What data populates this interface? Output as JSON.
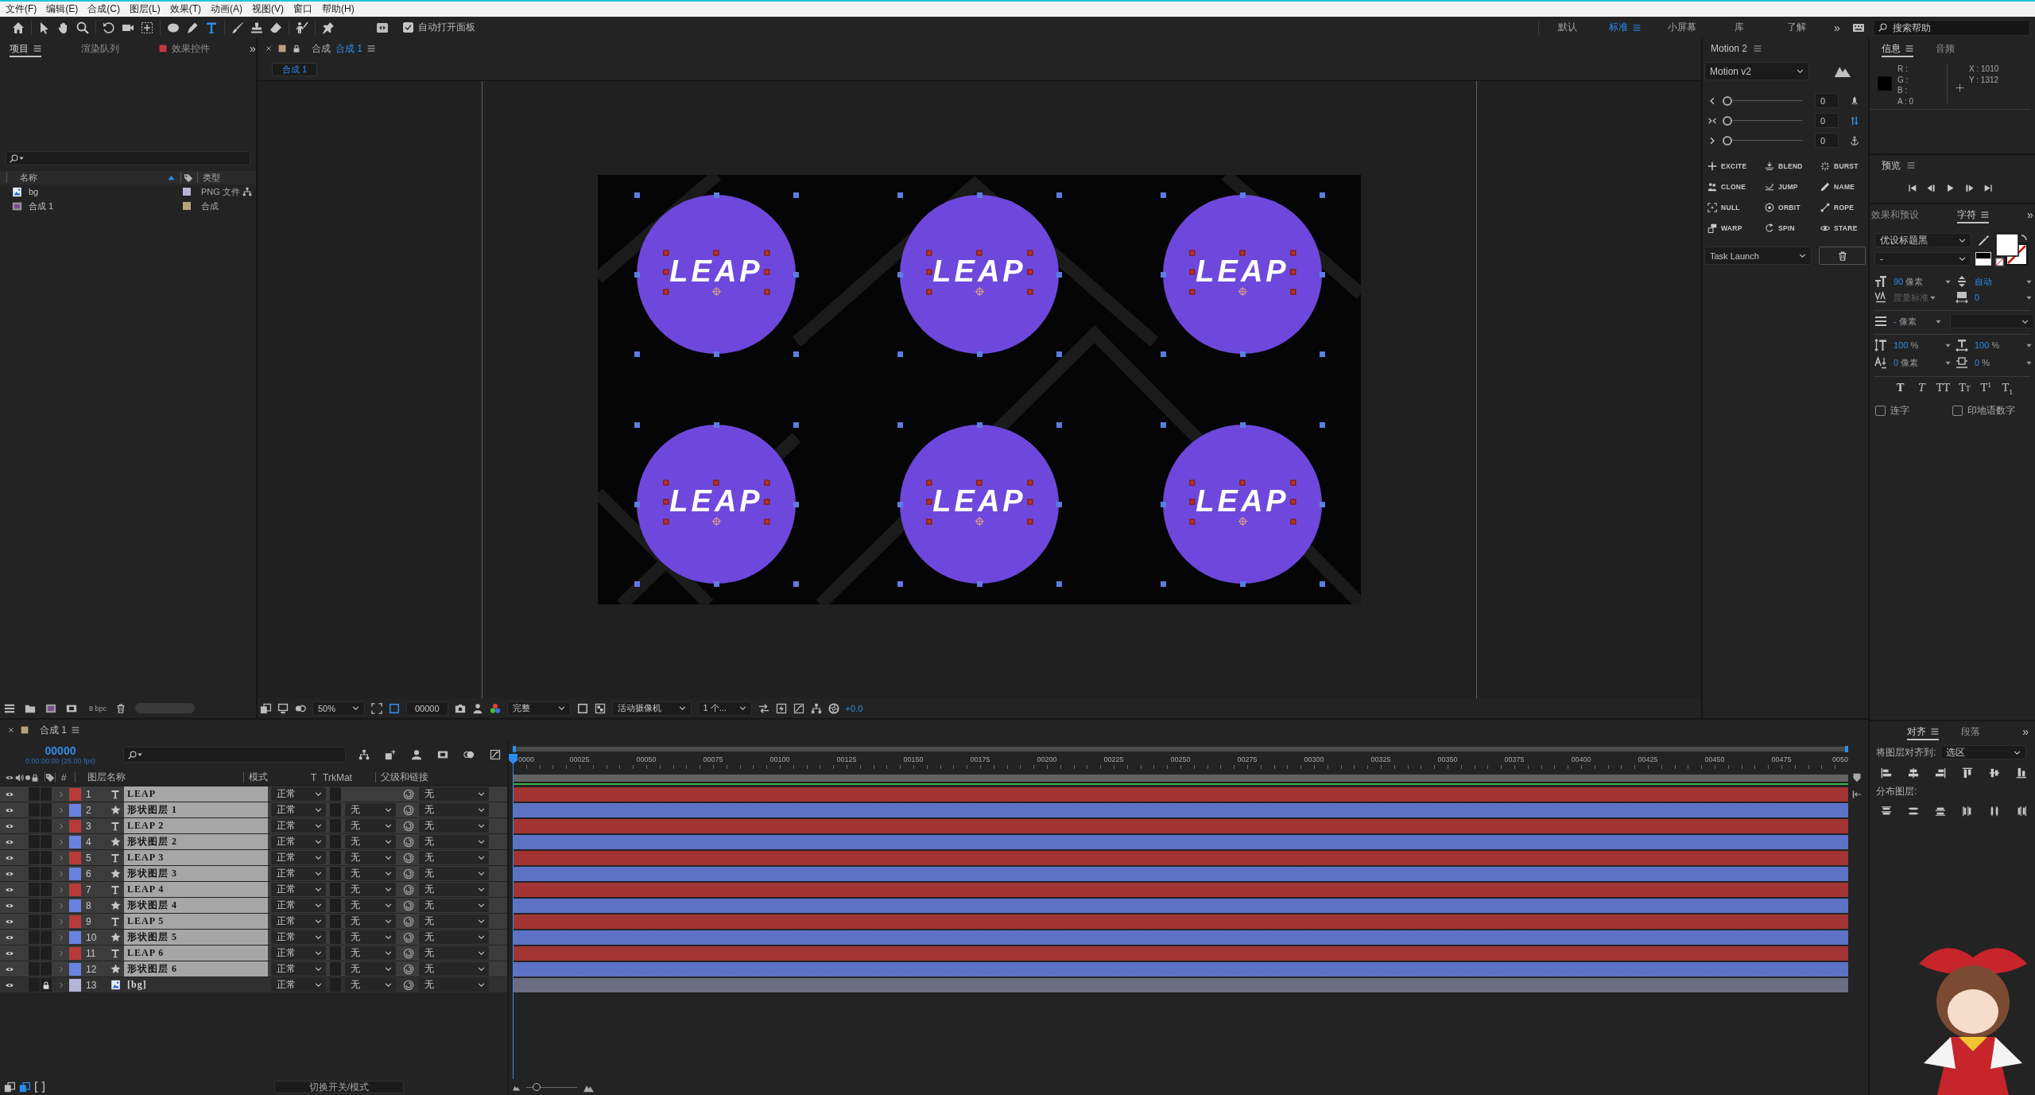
{
  "menu_bar": [
    "文件(F)",
    "编辑(E)",
    "合成(C)",
    "图层(L)",
    "效果(T)",
    "动画(A)",
    "视图(V)",
    "窗口",
    "帮助(H)"
  ],
  "toolbar": {
    "tools": [
      {
        "kind": "home",
        "selected": false
      },
      {
        "kind": "selection",
        "selected": false
      },
      {
        "kind": "hand",
        "selected": false
      },
      {
        "kind": "zoom",
        "selected": false
      },
      {
        "kind": "rotate",
        "selected": false
      },
      {
        "kind": "camera",
        "selected": false
      },
      {
        "kind": "pan-behind",
        "selected": false
      },
      {
        "kind": "ellipse",
        "selected": false
      },
      {
        "kind": "pen",
        "selected": false
      },
      {
        "kind": "type",
        "selected": true
      },
      {
        "kind": "brush",
        "selected": false
      },
      {
        "kind": "stamp",
        "selected": false
      },
      {
        "kind": "eraser",
        "selected": false
      },
      {
        "kind": "roto",
        "selected": false
      },
      {
        "kind": "pin",
        "selected": false
      }
    ],
    "auto_open_panels": {
      "label": "自动打开面板",
      "checked": true
    },
    "workspaces": [
      {
        "label": "默认",
        "selected": false
      },
      {
        "label": "标准",
        "selected": true
      },
      {
        "label": "小屏幕",
        "selected": false
      },
      {
        "label": "库",
        "selected": false
      },
      {
        "label": "了解",
        "selected": false
      }
    ],
    "overflow": "»",
    "help_search": {
      "placeholder": "搜索帮助"
    }
  },
  "project_panel": {
    "tabs": [
      {
        "label": "项目",
        "selected": true
      },
      {
        "label": "渲染队列",
        "selected": false
      },
      {
        "label": "效果控件",
        "selected": false
      }
    ],
    "overflow": "»",
    "columns": [
      "名称",
      "类型"
    ],
    "items": [
      {
        "kind": "footage",
        "name": "bg",
        "type": "PNG 文件",
        "color": "#b4b4d8"
      },
      {
        "kind": "composition",
        "name": "合成 1",
        "type": "合成",
        "color": "#b8a27c"
      }
    ],
    "bit_depth": "8 bpc"
  },
  "composition_viewer": {
    "tab": {
      "prefix": "合成",
      "name": "合成 1"
    },
    "breadcrumb": "合成 1",
    "circles": [
      {
        "label": "LEAP",
        "selected": true
      },
      {
        "label": "LEAP",
        "selected": true
      },
      {
        "label": "LEAP",
        "selected": true
      },
      {
        "label": "LEAP",
        "selected": true
      },
      {
        "label": "LEAP",
        "selected": true
      },
      {
        "label": "LEAP",
        "selected": true
      }
    ],
    "magnification": "50%",
    "timecode": "00000",
    "resolution": "完整",
    "camera": "活动摄像机",
    "views": "1 个...",
    "exposure": "+0.0"
  },
  "motion_panel": {
    "title": "Motion 2",
    "preset": "Motion v2",
    "sliders": [
      {
        "level": 0,
        "value": "0"
      },
      {
        "level": 0,
        "value": "0"
      },
      {
        "level": 0,
        "value": "0"
      }
    ],
    "tools": [
      {
        "kind": "excite",
        "label": "EXCITE"
      },
      {
        "kind": "blend",
        "label": "BLEND"
      },
      {
        "kind": "burst",
        "label": "BURST"
      },
      {
        "kind": "clone",
        "label": "CLONE"
      },
      {
        "kind": "jump",
        "label": "JUMP"
      },
      {
        "kind": "name",
        "label": "NAME"
      },
      {
        "kind": "null",
        "label": "NULL"
      },
      {
        "kind": "orbit",
        "label": "ORBIT"
      },
      {
        "kind": "rope",
        "label": "ROPE"
      },
      {
        "kind": "warp",
        "label": "WARP"
      },
      {
        "kind": "spin",
        "label": "SPIN"
      },
      {
        "kind": "stare",
        "label": "STARE"
      }
    ],
    "task": "Task Launch"
  },
  "info_panel": {
    "tabs": [
      {
        "label": "信息",
        "selected": true
      },
      {
        "label": "音频",
        "selected": false
      }
    ],
    "color_readout": [
      "R :",
      "G :",
      "B :",
      "A : 0"
    ],
    "position_readout": [
      "X : 1010",
      "Y : 1312"
    ]
  },
  "preview_panel": {
    "title": "预览"
  },
  "character_panel": {
    "tabs": [
      {
        "label": "效果和预设",
        "selected": false
      },
      {
        "label": "字符",
        "selected": true
      }
    ],
    "overflow": "»",
    "font": "优设标题黑",
    "style": "-",
    "size": {
      "value": "90",
      "unit": "像素"
    },
    "leading": {
      "value": "自动"
    },
    "kerning": {
      "value": "度量标准",
      "disabled": true
    },
    "tracking": {
      "value": "0"
    },
    "stroke_width": {
      "value": "-",
      "unit": "像素"
    },
    "vertical_scale": {
      "value": "100",
      "unit": "%"
    },
    "horizontal_scale": {
      "value": "100",
      "unit": "%"
    },
    "baseline_shift": {
      "value": "0",
      "unit": "像素"
    },
    "tsume": {
      "value": "0",
      "unit": "%"
    },
    "style_buttons": [
      {
        "kind": "bold",
        "label": "T"
      },
      {
        "kind": "italic",
        "label": "T"
      },
      {
        "kind": "all-caps",
        "label": "TT"
      },
      {
        "kind": "small-caps",
        "label": "TT"
      },
      {
        "kind": "superscript",
        "label": "T$^{1}$"
      },
      {
        "kind": "subscript",
        "label": "T$_{1}$"
      }
    ],
    "options": [
      {
        "label": "连字",
        "checked": false
      },
      {
        "label": "印地语数字",
        "checked": false
      }
    ]
  },
  "align_panel": {
    "tabs": [
      {
        "label": "对齐",
        "selected": true
      },
      {
        "label": "段落",
        "selected": false
      }
    ],
    "overflow": "»",
    "align_to_label": "将图层对齐到:",
    "align_to": "选区",
    "distribute_label": "分布图层:"
  },
  "timeline": {
    "tab": "合成 1",
    "timecode": "00000",
    "timecode_detail": "0:00:00:00 (25.00 fps)",
    "columns": {
      "number": "#",
      "layer_name": "图层名称",
      "mode": "模式",
      "preserve": "T",
      "track_matte": "TrkMat",
      "parent": "父级和链接"
    },
    "ruler": [
      "0000",
      "00025",
      "00050",
      "00075",
      "00100",
      "00125",
      "00150",
      "00175",
      "00200",
      "00225",
      "00250",
      "00275",
      "00300",
      "00325",
      "00350",
      "00375",
      "00400",
      "00425",
      "00450",
      "00475",
      "0050"
    ],
    "layers": [
      {
        "number": "1",
        "kind": "text",
        "name": "LEAP",
        "color": "#b83b3b",
        "visible": true,
        "solo": false,
        "locked": false,
        "selected": true,
        "mode": "正常",
        "preserve_transparency": false,
        "parent": "无"
      },
      {
        "number": "2",
        "kind": "shape",
        "name": "形状图层 1",
        "color": "#6a82e0",
        "visible": true,
        "solo": false,
        "locked": false,
        "selected": true,
        "mode": "正常",
        "preserve_transparency": false,
        "trkmat": "无",
        "parent": "无"
      },
      {
        "number": "3",
        "kind": "text",
        "name": "LEAP 2",
        "color": "#b83b3b",
        "visible": true,
        "solo": false,
        "locked": false,
        "selected": true,
        "mode": "正常",
        "preserve_transparency": false,
        "trkmat": "无",
        "parent": "无"
      },
      {
        "number": "4",
        "kind": "shape",
        "name": "形状图层 2",
        "color": "#6a82e0",
        "visible": true,
        "solo": false,
        "locked": false,
        "selected": true,
        "mode": "正常",
        "preserve_transparency": false,
        "trkmat": "无",
        "parent": "无"
      },
      {
        "number": "5",
        "kind": "text",
        "name": "LEAP 3",
        "color": "#b83b3b",
        "visible": true,
        "solo": false,
        "locked": false,
        "selected": true,
        "mode": "正常",
        "preserve_transparency": false,
        "trkmat": "无",
        "parent": "无"
      },
      {
        "number": "6",
        "kind": "shape",
        "name": "形状图层 3",
        "color": "#6a82e0",
        "visible": true,
        "solo": false,
        "locked": false,
        "selected": true,
        "mode": "正常",
        "preserve_transparency": false,
        "trkmat": "无",
        "parent": "无"
      },
      {
        "number": "7",
        "kind": "text",
        "name": "LEAP 4",
        "color": "#b83b3b",
        "visible": true,
        "solo": false,
        "locked": false,
        "selected": true,
        "mode": "正常",
        "preserve_transparency": false,
        "trkmat": "无",
        "parent": "无"
      },
      {
        "number": "8",
        "kind": "shape",
        "name": "形状图层 4",
        "color": "#6a82e0",
        "visible": true,
        "solo": false,
        "locked": false,
        "selected": true,
        "mode": "正常",
        "preserve_transparency": false,
        "trkmat": "无",
        "parent": "无"
      },
      {
        "number": "9",
        "kind": "text",
        "name": "LEAP 5",
        "color": "#b83b3b",
        "visible": true,
        "solo": false,
        "locked": false,
        "selected": true,
        "mode": "正常",
        "preserve_transparency": false,
        "trkmat": "无",
        "parent": "无"
      },
      {
        "number": "10",
        "kind": "shape",
        "name": "形状图层 5",
        "color": "#6a82e0",
        "visible": true,
        "solo": false,
        "locked": false,
        "selected": true,
        "mode": "正常",
        "preserve_transparency": false,
        "trkmat": "无",
        "parent": "无"
      },
      {
        "number": "11",
        "kind": "text",
        "name": "LEAP 6",
        "color": "#b83b3b",
        "visible": true,
        "solo": false,
        "locked": false,
        "selected": true,
        "mode": "正常",
        "preserve_transparency": false,
        "trkmat": "无",
        "parent": "无"
      },
      {
        "number": "12",
        "kind": "shape",
        "name": "形状图层 6",
        "color": "#6a82e0",
        "visible": true,
        "solo": false,
        "locked": false,
        "selected": true,
        "mode": "正常",
        "preserve_transparency": false,
        "trkmat": "无",
        "parent": "无"
      },
      {
        "number": "13",
        "kind": "footage",
        "name": "[bg]",
        "color": "#b4b4d8",
        "visible": true,
        "solo": false,
        "locked": true,
        "selected": false,
        "mode": "正常",
        "preserve_transparency": false,
        "trkmat": "无",
        "parent": "无"
      }
    ],
    "toggle_label": "切换开关/模式",
    "zoom": {
      "level": 0.2
    }
  }
}
